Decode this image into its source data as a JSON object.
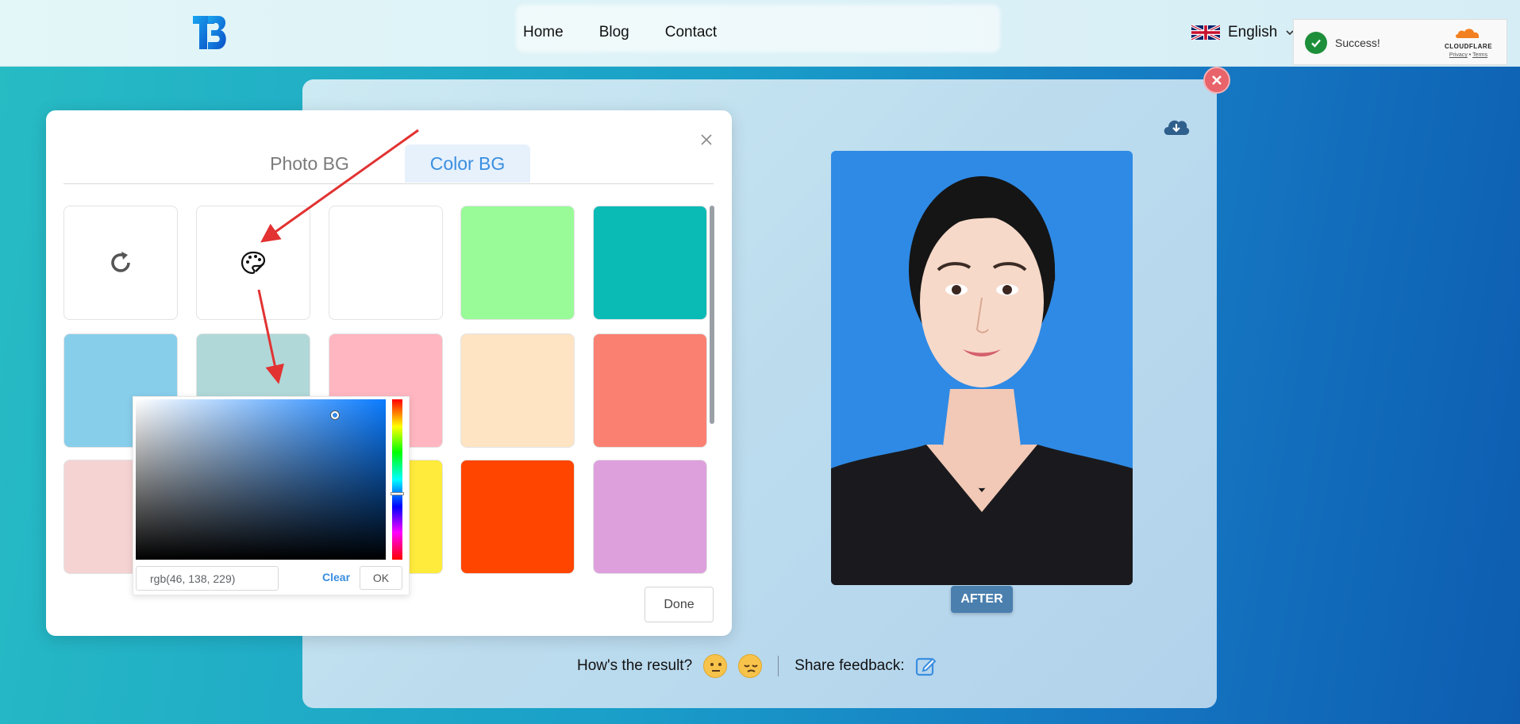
{
  "header": {
    "nav": [
      "Home",
      "Blog",
      "Contact"
    ],
    "language": "English",
    "captcha": {
      "status": "Success!",
      "brand": "CLOUDFLARE",
      "privacy": "Privacy",
      "terms": "Terms",
      "separator": "•"
    }
  },
  "modal": {
    "tabs": {
      "photo": "Photo BG",
      "color": "Color BG"
    },
    "swatch_colors": [
      "#ffffff",
      "#98fb98",
      "#0abab5",
      "#87ceeb",
      "#b0d8d8",
      "#ffb6c1",
      "#ffe4c4",
      "#fa8072",
      "#f5d3d3",
      "#ffeb3b",
      "#ff4500",
      "#dda0dd"
    ],
    "done_label": "Done"
  },
  "picker": {
    "value": "rgb(46, 138, 229)",
    "clear_label": "Clear",
    "ok_label": "OK"
  },
  "result": {
    "photo_bg": "#2f8ae5",
    "badge": "AFTER",
    "question": "How's the result?",
    "share": "Share feedback:"
  }
}
